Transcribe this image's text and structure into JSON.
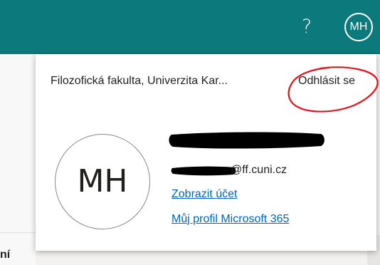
{
  "header": {
    "help_label": "?",
    "user_initials": "MH",
    "background_color": "#0c7a7c"
  },
  "page": {
    "partial_left_text": "ní"
  },
  "account_panel": {
    "organization": "Filozofická fakulta, Univerzita Kar...",
    "sign_out_label": "Odhlásit se",
    "user_initials": "MH",
    "email_visible": "@ff.cuni.cz",
    "view_account_label": "Zobrazit účet",
    "profile_label": "Můj profil Microsoft 365",
    "link_color": "#0067b8",
    "annotation_color": "#e8121b"
  }
}
